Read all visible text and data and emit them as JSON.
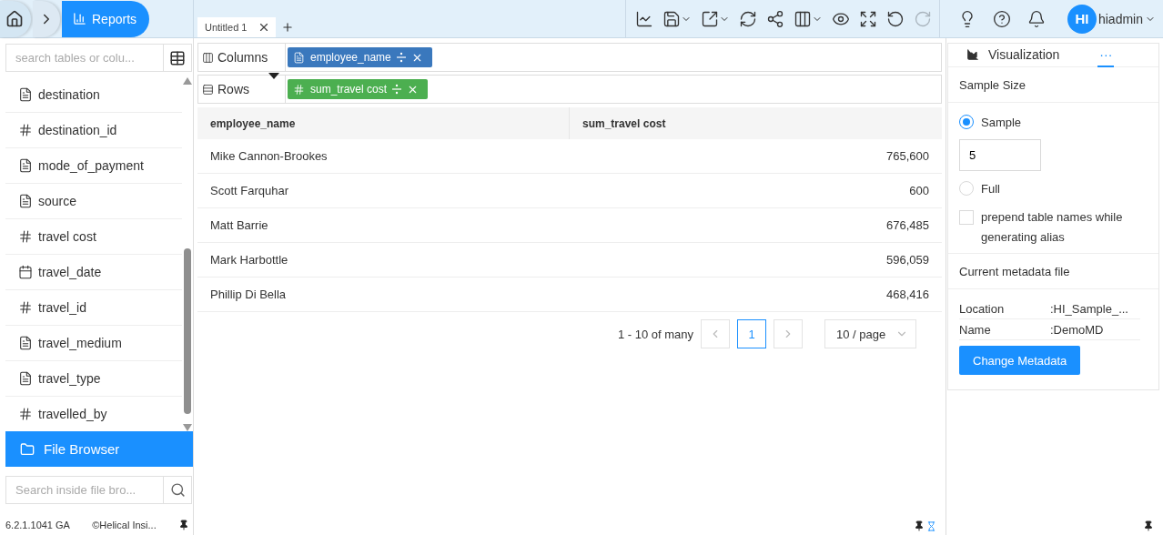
{
  "breadcrumb": {
    "current": "Reports"
  },
  "tabs": [
    {
      "label": "Untitled 1",
      "selected": true
    }
  ],
  "toolbar": [
    {
      "kind": "chart",
      "menu": false,
      "disabled": false
    },
    {
      "kind": "save",
      "menu": true,
      "disabled": false
    },
    {
      "kind": "export",
      "menu": true,
      "disabled": false
    },
    {
      "kind": "refresh",
      "menu": false,
      "disabled": false
    },
    {
      "kind": "share",
      "menu": false,
      "disabled": false
    },
    {
      "kind": "layout",
      "menu": true,
      "disabled": false
    },
    {
      "kind": "preview",
      "menu": false,
      "disabled": false
    },
    {
      "kind": "fullscreen",
      "menu": false,
      "disabled": false
    },
    {
      "kind": "undo",
      "menu": false,
      "disabled": false
    },
    {
      "kind": "redo",
      "menu": false,
      "disabled": true
    }
  ],
  "utilities": [
    {
      "kind": "idea"
    },
    {
      "kind": "help"
    },
    {
      "kind": "notifications"
    }
  ],
  "user": {
    "initials": "HI",
    "name": "hiadmin"
  },
  "left": {
    "search": {
      "placeholder": "search tables or colu..."
    },
    "fields": [
      {
        "name": "destination",
        "kind": "text"
      },
      {
        "name": "destination_id",
        "kind": "number"
      },
      {
        "name": "mode_of_payment",
        "kind": "text"
      },
      {
        "name": "source",
        "kind": "text"
      },
      {
        "name": "travel cost",
        "kind": "number"
      },
      {
        "name": "travel_date",
        "kind": "date"
      },
      {
        "name": "travel_id",
        "kind": "number"
      },
      {
        "name": "travel_medium",
        "kind": "text"
      },
      {
        "name": "travel_type",
        "kind": "text"
      },
      {
        "name": "travelled_by",
        "kind": "number"
      }
    ],
    "file_browser": {
      "label": "File Browser"
    },
    "file_search": {
      "placeholder": "Search inside file bro..."
    },
    "version": "6.2.1.1041 GA",
    "copyright": "©Helical Insi..."
  },
  "shelves": [
    {
      "label": "Columns",
      "kind": "columns",
      "pills": [
        {
          "label": "employee_name",
          "kind": "text"
        }
      ]
    },
    {
      "label": "Rows",
      "kind": "rows",
      "pills": [
        {
          "label": "sum_travel cost",
          "kind": "number"
        }
      ]
    }
  ],
  "table": {
    "columns": [
      "employee_name",
      "sum_travel cost"
    ],
    "rows": [
      [
        "Mike Cannon-Brookes",
        "765,600"
      ],
      [
        "Scott Farquhar",
        "600"
      ],
      [
        "Matt Barrie",
        "676,485"
      ],
      [
        "Mark Harbottle",
        "596,059"
      ],
      [
        "Phillip Di Bella",
        "468,416"
      ]
    ]
  },
  "pagination": {
    "range": "1 - 10 of many",
    "pages": [
      {
        "label": "1",
        "selected": true
      }
    ],
    "page_size": "10 / page"
  },
  "right": {
    "tabs": [
      {
        "label": "Visualization",
        "kind": "visualization",
        "selected": false
      },
      {
        "label": "···",
        "kind": "more",
        "selected": true
      }
    ],
    "sample_size": {
      "title": "Sample Size",
      "options": [
        {
          "label": "Sample",
          "selected": true
        },
        {
          "label": "Full",
          "selected": false
        }
      ],
      "sample_value": "5",
      "prepend": {
        "label": "prepend table names while generating alias",
        "checked": false
      }
    },
    "metadata": {
      "title": "Current metadata file",
      "rows": [
        {
          "label": "Location",
          "value": ":HI_Sample_..."
        },
        {
          "label": "Name",
          "value": ":DemoMD"
        }
      ],
      "button": "Change Metadata"
    }
  }
}
